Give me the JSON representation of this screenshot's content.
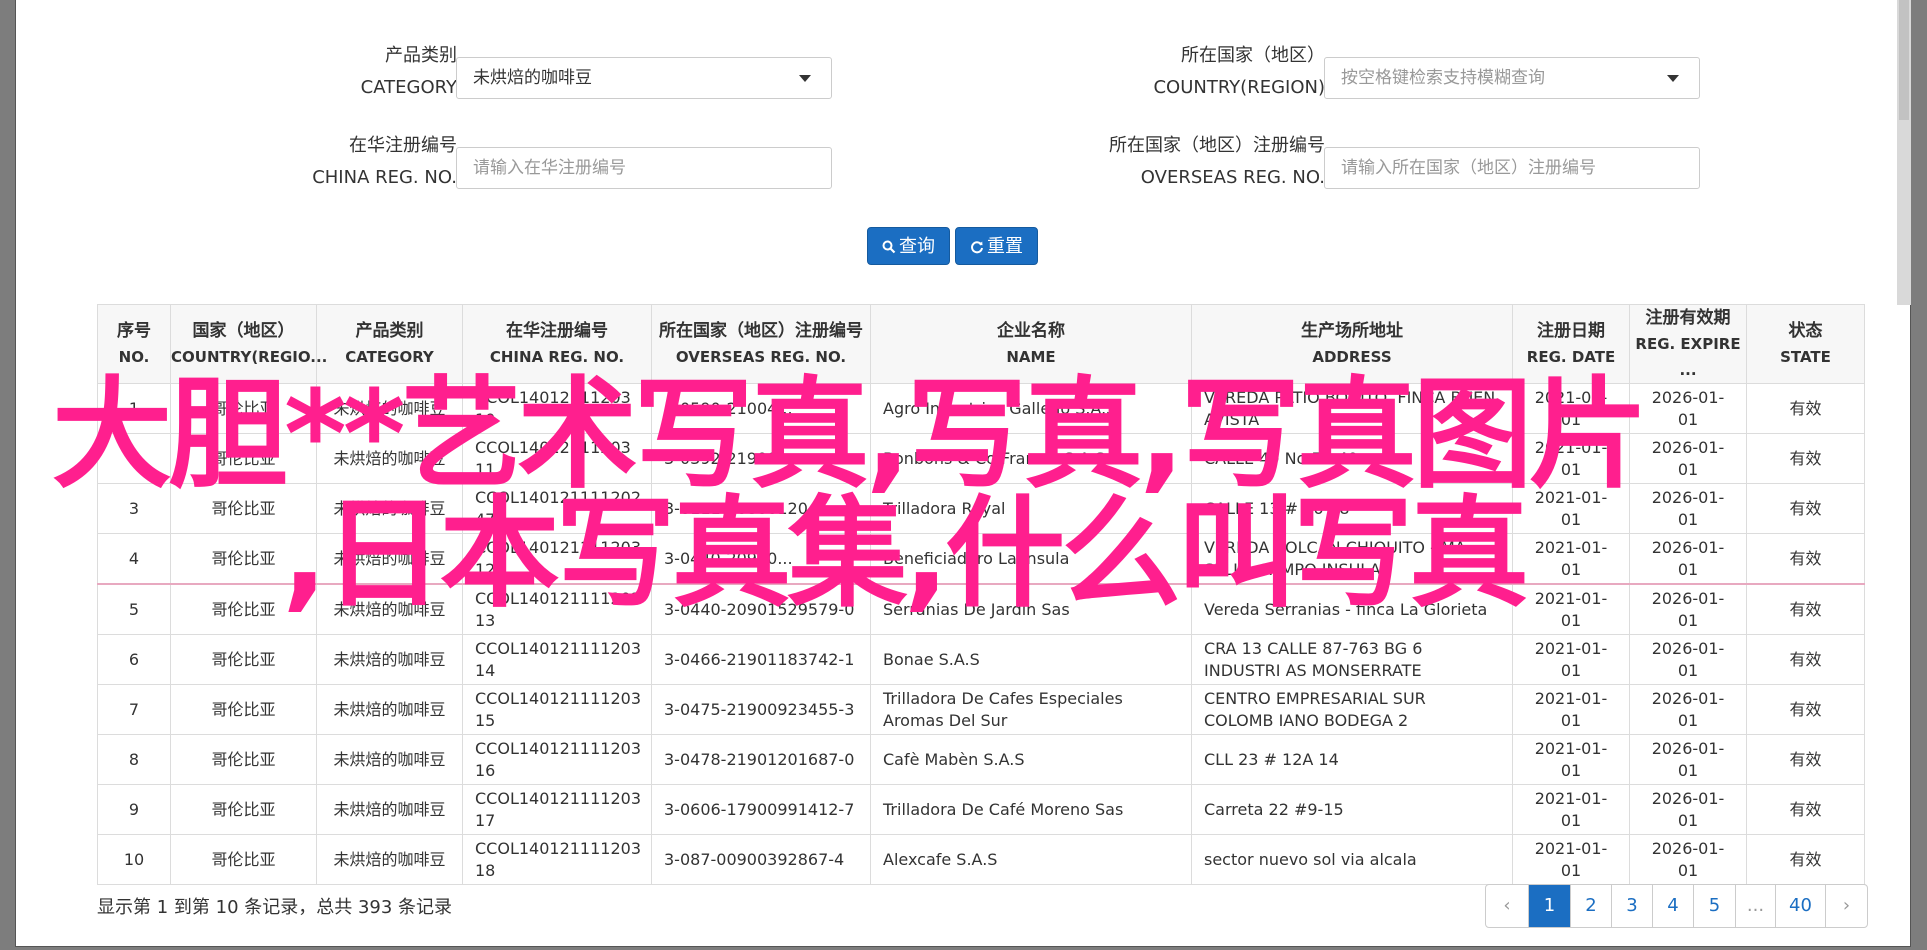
{
  "form": {
    "category": {
      "label_cn": "产品类别",
      "label_en": "CATEGORY",
      "value": "未烘焙的咖啡豆"
    },
    "country": {
      "label_cn": "所在国家（地区）",
      "label_en": "COUNTRY(REGION)",
      "placeholder": "按空格键检索支持模糊查询"
    },
    "china_reg": {
      "label_cn": "在华注册编号",
      "label_en": "CHINA REG. NO.",
      "placeholder": "请输入在华注册编号"
    },
    "overseas_reg": {
      "label_cn": "所在国家（地区）注册编号",
      "label_en": "OVERSEAS REG. NO.",
      "placeholder": "请输入所在国家（地区）注册编号"
    },
    "search_button": "查询",
    "reset_button": "重置"
  },
  "table": {
    "headers": [
      {
        "cn": "序号",
        "en": "NO."
      },
      {
        "cn": "国家（地区）",
        "en": "COUNTRY(REGIO..."
      },
      {
        "cn": "产品类别",
        "en": "CATEGORY"
      },
      {
        "cn": "在华注册编号",
        "en": "CHINA REG. NO."
      },
      {
        "cn": "所在国家（地区）注册编号",
        "en": "OVERSEAS REG. NO."
      },
      {
        "cn": "企业名称",
        "en": "NAME"
      },
      {
        "cn": "生产场所地址",
        "en": "ADDRESS"
      },
      {
        "cn": "注册日期",
        "en": "REG. DATE"
      },
      {
        "cn": "注册有效期",
        "en": "REG. EXPIRE ..."
      },
      {
        "cn": "状态",
        "en": "STATE"
      }
    ],
    "rows": [
      [
        "1",
        "哥伦比亚",
        "未烘焙的咖啡豆",
        "CCOL14012111203\n10",
        "3-0590-21004...",
        "Agro Industrias Gallego S.A.S",
        "VEREDA PATIO BONITO, FINCA BUEN AVISTA",
        "2021-01-01",
        "2026-01-01",
        "有效"
      ],
      [
        "2",
        "哥伦比亚",
        "未烘焙的咖啡豆",
        "CCOL14012111203\n11",
        "3-0392-21900...",
        "Bonbons & Co Francia S.A.S",
        "CALLE 49 No 55-40",
        "2021-01-01",
        "2026-01-01",
        "有效"
      ],
      [
        "3",
        "哥伦比亚",
        "未烘焙的咖啡豆",
        "CCOL140121111202\n47",
        "3-0111-20800120...",
        "Trilladora Royal",
        "CALLE 13 # 36-28",
        "2021-01-01",
        "2026-01-01",
        "有效"
      ],
      [
        "4",
        "哥伦比亚",
        "未烘焙的咖啡豆",
        "CCOL140121111203\n12",
        "3-0440-20900...",
        "Beneficiadero La Insula",
        "VEREDA VOLCAN CHIQUITO - MA SELLA CAMPO INSULA",
        "2021-01-01",
        "2026-01-01",
        "有效"
      ],
      [
        "5",
        "哥伦比亚",
        "未烘焙的咖啡豆",
        "CCOL140121111203\n13",
        "3-0440-20901529579-0",
        "Serranias De Jardin Sas",
        "Vereda Serranias - finca La Glorieta",
        "2021-01-01",
        "2026-01-01",
        "有效"
      ],
      [
        "6",
        "哥伦比亚",
        "未烘焙的咖啡豆",
        "CCOL140121111203\n14",
        "3-0466-21901183742-1",
        "Bonae S.A.S",
        "CRA 13 CALLE 87-763 BG 6 INDUSTRI AS MONSERRATE",
        "2021-01-01",
        "2026-01-01",
        "有效"
      ],
      [
        "7",
        "哥伦比亚",
        "未烘焙的咖啡豆",
        "CCOL140121111203\n15",
        "3-0475-21900923455-3",
        "Trilladora De Cafes Especiales Aromas Del Sur",
        "CENTRO EMPRESARIAL SUR COLOMB IANO BODEGA 2",
        "2021-01-01",
        "2026-01-01",
        "有效"
      ],
      [
        "8",
        "哥伦比亚",
        "未烘焙的咖啡豆",
        "CCOL140121111203\n16",
        "3-0478-21901201687-0",
        "Cafè Mabèn S.A.S",
        "CLL 23 # 12A 14",
        "2021-01-01",
        "2026-01-01",
        "有效"
      ],
      [
        "9",
        "哥伦比亚",
        "未烘焙的咖啡豆",
        "CCOL140121111203\n17",
        "3-0606-17900991412-7",
        "Trilladora De Café Moreno Sas",
        "Carreta 22 #9-15",
        "2021-01-01",
        "2026-01-01",
        "有效"
      ],
      [
        "10",
        "哥伦比亚",
        "未烘焙的咖啡豆",
        "CCOL140121111203\n18",
        "3-087-00900392867-4",
        "Alexcafe S.A.S",
        "sector nuevo sol via alcala",
        "2021-01-01",
        "2026-01-01",
        "有效"
      ]
    ]
  },
  "pagination": {
    "info": "显示第 1 到第 10 条记录，总共 393 条记录",
    "prev": "‹",
    "pages": [
      "1",
      "2",
      "3",
      "4",
      "5",
      "...",
      "40"
    ],
    "next": "›"
  },
  "overlay": {
    "line1": "大胆**艺术写真,写真,写真图片",
    "line2": ",日本写真集,什么叫写真"
  },
  "colors": {
    "accent": "#1b6ec2",
    "overlay": "#ff1f8e"
  }
}
